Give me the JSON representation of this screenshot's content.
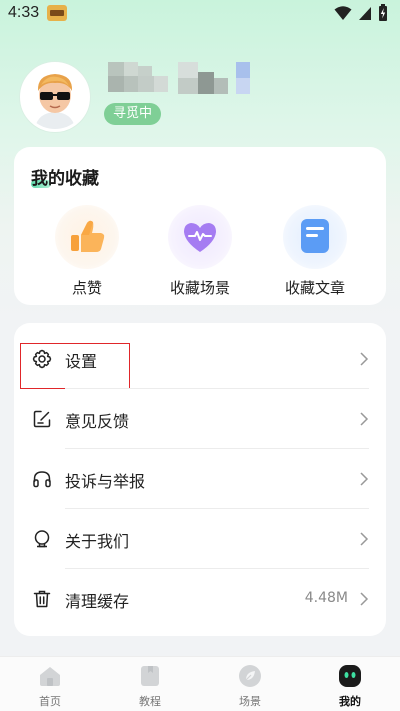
{
  "status_bar": {
    "time": "4:33"
  },
  "profile": {
    "status_tag": "寻觅中"
  },
  "favorites": {
    "title": "我的收藏",
    "items": [
      {
        "label": "点赞",
        "icon": "thumbs-up-icon"
      },
      {
        "label": "收藏场景",
        "icon": "heart-icon"
      },
      {
        "label": "收藏文章",
        "icon": "document-icon"
      }
    ]
  },
  "menu": {
    "items": [
      {
        "label": "设置",
        "icon": "gear-icon"
      },
      {
        "label": "意见反馈",
        "icon": "feedback-icon"
      },
      {
        "label": "投诉与举报",
        "icon": "headphones-icon"
      },
      {
        "label": "关于我们",
        "icon": "about-icon"
      },
      {
        "label": "清理缓存",
        "icon": "trash-icon",
        "value": "4.48M"
      }
    ]
  },
  "bottom_nav": {
    "items": [
      {
        "label": "首页",
        "icon": "home-icon"
      },
      {
        "label": "教程",
        "icon": "book-icon"
      },
      {
        "label": "场景",
        "icon": "leaf-icon"
      },
      {
        "label": "我的",
        "icon": "profile-icon",
        "active": true
      }
    ]
  },
  "colors": {
    "accent_green": "#7fcf96",
    "highlight_red": "#e0262a"
  }
}
